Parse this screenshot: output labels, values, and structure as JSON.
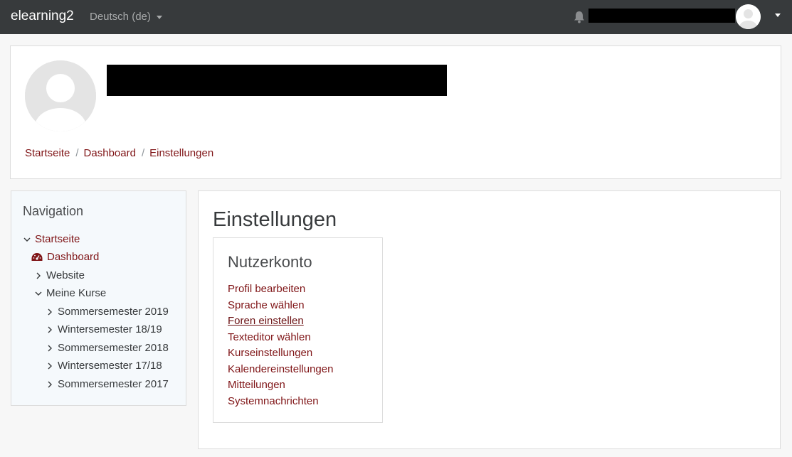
{
  "topbar": {
    "brand": "elearning2",
    "language": "Deutsch (de)",
    "icons": {
      "notifications": "bell-icon",
      "user_menu": "chevron-down-icon"
    }
  },
  "header": {
    "breadcrumb": [
      "Startseite",
      "Dashboard",
      "Einstellungen"
    ]
  },
  "navigation": {
    "title": "Navigation",
    "items": [
      {
        "label": "Startseite",
        "icon": "chevron-down-icon",
        "link": true
      },
      {
        "label": "Dashboard",
        "icon": "dashboard-icon",
        "link": true
      },
      {
        "label": "Website",
        "icon": "chevron-right-icon",
        "link": false
      },
      {
        "label": "Meine Kurse",
        "icon": "chevron-down-icon",
        "link": false
      },
      {
        "label": "Sommersemester 2019",
        "icon": "chevron-right-icon",
        "link": false
      },
      {
        "label": "Wintersemester 18/19",
        "icon": "chevron-right-icon",
        "link": false
      },
      {
        "label": "Sommersemester 2018",
        "icon": "chevron-right-icon",
        "link": false
      },
      {
        "label": "Wintersemester 17/18",
        "icon": "chevron-right-icon",
        "link": false
      },
      {
        "label": "Sommersemester 2017",
        "icon": "chevron-right-icon",
        "link": false
      }
    ]
  },
  "main": {
    "title": "Einstellungen",
    "section": {
      "title": "Nutzerkonto",
      "links": [
        "Profil bearbeiten",
        "Sprache wählen",
        "Foren einstellen",
        "Texteditor wählen",
        "Kurseinstellungen",
        "Kalendereinstellungen",
        "Mitteilungen",
        "Systemnachrichten"
      ]
    }
  },
  "colors": {
    "topbar": "#373a3c",
    "link": "#7f1416",
    "nav_bg": "#f5f9fc",
    "border": "#dcdcdc"
  }
}
